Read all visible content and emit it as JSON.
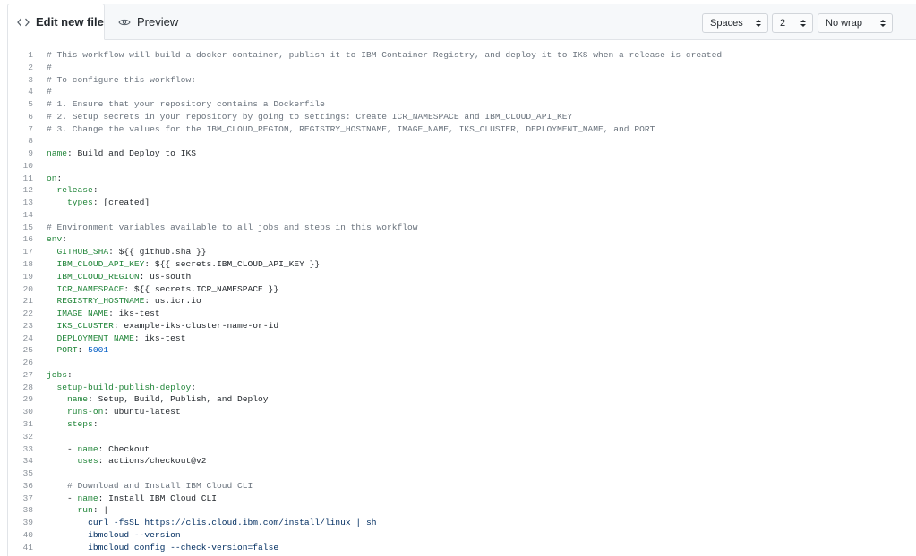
{
  "tabs": {
    "edit": {
      "label": "Edit new file",
      "icon": "code-icon"
    },
    "preview": {
      "label": "Preview",
      "icon": "eye-icon"
    }
  },
  "options": {
    "indent_mode": "Spaces",
    "indent_size": "2",
    "wrap_mode": "No wrap"
  },
  "colors": {
    "comment": "#6a737d",
    "key": "#22863a",
    "number": "#005cc5",
    "string": "#032f62",
    "line_number": "#8b929a"
  },
  "code_lines": [
    {
      "n": "1",
      "t": [
        [
          "# This workflow will build a docker container, publish it to IBM Container Registry, and deploy it to IKS when a release is created",
          "c"
        ]
      ]
    },
    {
      "n": "2",
      "t": [
        [
          "#",
          "c"
        ]
      ]
    },
    {
      "n": "3",
      "t": [
        [
          "# To configure this workflow:",
          "c"
        ]
      ]
    },
    {
      "n": "4",
      "t": [
        [
          "#",
          "c"
        ]
      ]
    },
    {
      "n": "5",
      "t": [
        [
          "# 1. Ensure that your repository contains a Dockerfile",
          "c"
        ]
      ]
    },
    {
      "n": "6",
      "t": [
        [
          "# 2. Setup secrets in your repository by going to settings: Create ICR_NAMESPACE and IBM_CLOUD_API_KEY",
          "c"
        ]
      ]
    },
    {
      "n": "7",
      "t": [
        [
          "# 3. Change the values for the IBM_CLOUD_REGION, REGISTRY_HOSTNAME, IMAGE_NAME, IKS_CLUSTER, DEPLOYMENT_NAME, and PORT",
          "c"
        ]
      ]
    },
    {
      "n": "8",
      "t": []
    },
    {
      "n": "9",
      "t": [
        [
          "name",
          "k"
        ],
        [
          ": ",
          ""
        ],
        [
          "Build and Deploy to IKS",
          ""
        ]
      ]
    },
    {
      "n": "10",
      "t": []
    },
    {
      "n": "11",
      "t": [
        [
          "on",
          "k"
        ],
        [
          ":",
          ""
        ]
      ]
    },
    {
      "n": "12",
      "t": [
        [
          "  ",
          ""
        ],
        [
          "release",
          "k"
        ],
        [
          ":",
          ""
        ]
      ]
    },
    {
      "n": "13",
      "t": [
        [
          "    ",
          ""
        ],
        [
          "types",
          "k"
        ],
        [
          ": [created]",
          ""
        ]
      ]
    },
    {
      "n": "14",
      "t": []
    },
    {
      "n": "15",
      "t": [
        [
          "# Environment variables available to all jobs and steps in this workflow",
          "c"
        ]
      ]
    },
    {
      "n": "16",
      "t": [
        [
          "env",
          "k"
        ],
        [
          ":",
          ""
        ]
      ]
    },
    {
      "n": "17",
      "t": [
        [
          "  ",
          ""
        ],
        [
          "GITHUB_SHA",
          "k"
        ],
        [
          ": ${{ github.sha }}",
          ""
        ]
      ]
    },
    {
      "n": "18",
      "t": [
        [
          "  ",
          ""
        ],
        [
          "IBM_CLOUD_API_KEY",
          "k"
        ],
        [
          ": ${{ secrets.IBM_CLOUD_API_KEY }}",
          ""
        ]
      ]
    },
    {
      "n": "19",
      "t": [
        [
          "  ",
          ""
        ],
        [
          "IBM_CLOUD_REGION",
          "k"
        ],
        [
          ": us-south",
          ""
        ]
      ]
    },
    {
      "n": "20",
      "t": [
        [
          "  ",
          ""
        ],
        [
          "ICR_NAMESPACE",
          "k"
        ],
        [
          ": ${{ secrets.ICR_NAMESPACE }}",
          ""
        ]
      ]
    },
    {
      "n": "21",
      "t": [
        [
          "  ",
          ""
        ],
        [
          "REGISTRY_HOSTNAME",
          "k"
        ],
        [
          ": us.icr.io",
          ""
        ]
      ]
    },
    {
      "n": "22",
      "t": [
        [
          "  ",
          ""
        ],
        [
          "IMAGE_NAME",
          "k"
        ],
        [
          ": iks-test",
          ""
        ]
      ]
    },
    {
      "n": "23",
      "t": [
        [
          "  ",
          ""
        ],
        [
          "IKS_CLUSTER",
          "k"
        ],
        [
          ": example-iks-cluster-name-or-id",
          ""
        ]
      ]
    },
    {
      "n": "24",
      "t": [
        [
          "  ",
          ""
        ],
        [
          "DEPLOYMENT_NAME",
          "k"
        ],
        [
          ": iks-test",
          ""
        ]
      ]
    },
    {
      "n": "25",
      "t": [
        [
          "  ",
          ""
        ],
        [
          "PORT",
          "k"
        ],
        [
          ": ",
          ""
        ],
        [
          "5001",
          "n"
        ]
      ]
    },
    {
      "n": "26",
      "t": []
    },
    {
      "n": "27",
      "t": [
        [
          "jobs",
          "k"
        ],
        [
          ":",
          ""
        ]
      ]
    },
    {
      "n": "28",
      "t": [
        [
          "  ",
          ""
        ],
        [
          "setup-build-publish-deploy",
          "k"
        ],
        [
          ":",
          ""
        ]
      ]
    },
    {
      "n": "29",
      "t": [
        [
          "    ",
          ""
        ],
        [
          "name",
          "k"
        ],
        [
          ": Setup, Build, Publish, and Deploy",
          ""
        ]
      ]
    },
    {
      "n": "30",
      "t": [
        [
          "    ",
          ""
        ],
        [
          "runs-on",
          "k"
        ],
        [
          ": ubuntu-latest",
          ""
        ]
      ]
    },
    {
      "n": "31",
      "t": [
        [
          "    ",
          ""
        ],
        [
          "steps",
          "k"
        ],
        [
          ":",
          ""
        ]
      ]
    },
    {
      "n": "32",
      "t": []
    },
    {
      "n": "33",
      "t": [
        [
          "    - ",
          ""
        ],
        [
          "name",
          "k"
        ],
        [
          ": Checkout",
          ""
        ]
      ]
    },
    {
      "n": "34",
      "t": [
        [
          "      ",
          ""
        ],
        [
          "uses",
          "k"
        ],
        [
          ": actions/checkout@v2",
          ""
        ]
      ]
    },
    {
      "n": "35",
      "t": []
    },
    {
      "n": "36",
      "t": [
        [
          "    ",
          ""
        ],
        [
          "# Download and Install IBM Cloud CLI",
          "c"
        ]
      ]
    },
    {
      "n": "37",
      "t": [
        [
          "    - ",
          ""
        ],
        [
          "name",
          "k"
        ],
        [
          ": Install IBM Cloud CLI",
          ""
        ]
      ]
    },
    {
      "n": "38",
      "t": [
        [
          "      ",
          ""
        ],
        [
          "run",
          "k"
        ],
        [
          ": |",
          ""
        ]
      ]
    },
    {
      "n": "39",
      "t": [
        [
          "        ",
          ""
        ],
        [
          "curl -fsSL https://clis.cloud.ibm.com/install/linux | sh",
          "v"
        ]
      ]
    },
    {
      "n": "40",
      "t": [
        [
          "        ",
          ""
        ],
        [
          "ibmcloud --version",
          "v"
        ]
      ]
    },
    {
      "n": "41",
      "t": [
        [
          "        ",
          ""
        ],
        [
          "ibmcloud config --check-version=false",
          "v"
        ]
      ]
    }
  ]
}
